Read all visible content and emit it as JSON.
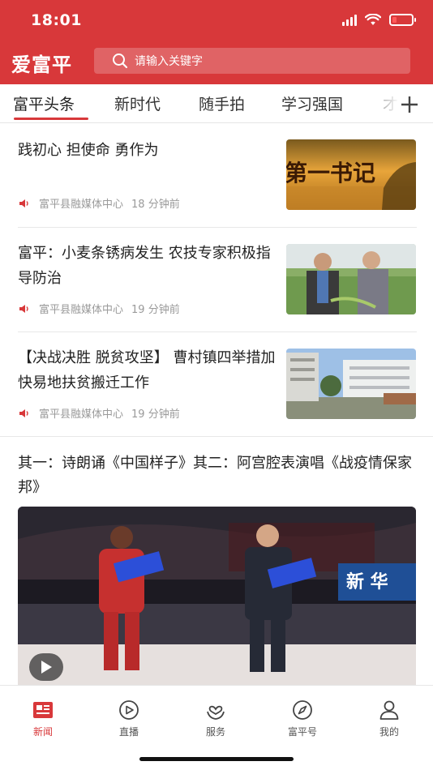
{
  "status_bar": {
    "time": "18:01"
  },
  "app": {
    "logo": "爱富平"
  },
  "search": {
    "placeholder": "请输入关键字"
  },
  "tabs": [
    {
      "label": "富平头条",
      "active": true
    },
    {
      "label": "新时代"
    },
    {
      "label": "随手拍"
    },
    {
      "label": "学习强国"
    },
    {
      "label": "才"
    }
  ],
  "news": [
    {
      "title": "践初心 担使命 勇作为",
      "source": "富平县融媒体中心",
      "time": "18 分钟前",
      "thumb_text": "第一书记"
    },
    {
      "title": "富平：小麦条锈病发生  农技专家积极指导防治",
      "source": "富平县融媒体中心",
      "time": "19 分钟前"
    },
    {
      "title": "【决战决胜 脱贫攻坚】 曹村镇四举措加快易地扶贫搬迁工作",
      "source": "富平县融媒体中心",
      "time": "19 分钟前"
    }
  ],
  "feature": {
    "title": "其一：诗朗诵《中国样子》其二：阿宫腔表演唱《战疫情保家邦》",
    "overlay_text": "新 华"
  },
  "bottom_nav": [
    {
      "label": "新闻",
      "icon": "news-icon",
      "active": true
    },
    {
      "label": "直播",
      "icon": "live-play-icon"
    },
    {
      "label": "服务",
      "icon": "service-heart-icon"
    },
    {
      "label": "富平号",
      "icon": "compass-icon"
    },
    {
      "label": "我的",
      "icon": "profile-icon"
    }
  ],
  "colors": {
    "brand_red": "#d8383a",
    "meta_gray": "#9a9a9a"
  }
}
